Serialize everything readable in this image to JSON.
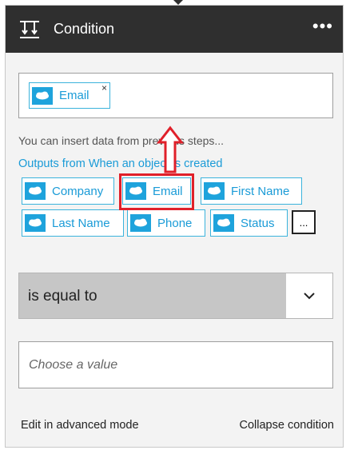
{
  "header": {
    "icon": "condition-icon",
    "title": "Condition",
    "menu_icon": "more-options-icon",
    "menu_glyph": "•••"
  },
  "condition_input": {
    "token": {
      "label": "Email",
      "icon": "salesforce-icon",
      "remove_glyph": "×"
    }
  },
  "hint_text": "You can insert data from previous steps...",
  "outputs_label": "Outputs from When an object is created",
  "output_tokens": [
    {
      "label": "Company",
      "icon": "salesforce-icon"
    },
    {
      "label": "Email",
      "icon": "salesforce-icon"
    },
    {
      "label": "First Name",
      "icon": "salesforce-icon"
    },
    {
      "label": "Last Name",
      "icon": "salesforce-icon"
    },
    {
      "label": "Phone",
      "icon": "salesforce-icon"
    },
    {
      "label": "Status",
      "icon": "salesforce-icon"
    }
  ],
  "more_button_label": "...",
  "operator": {
    "selected": "is equal to",
    "icon": "chevron-down-icon"
  },
  "value_field": {
    "value": "",
    "placeholder": "Choose a value"
  },
  "footer": {
    "advanced_mode": "Edit in advanced mode",
    "collapse": "Collapse condition"
  },
  "colors": {
    "header_bg": "#2f2f2f",
    "accent": "#1a9bd7",
    "salesforce_blue": "#1ea3dc",
    "highlight": "#e0202a"
  }
}
